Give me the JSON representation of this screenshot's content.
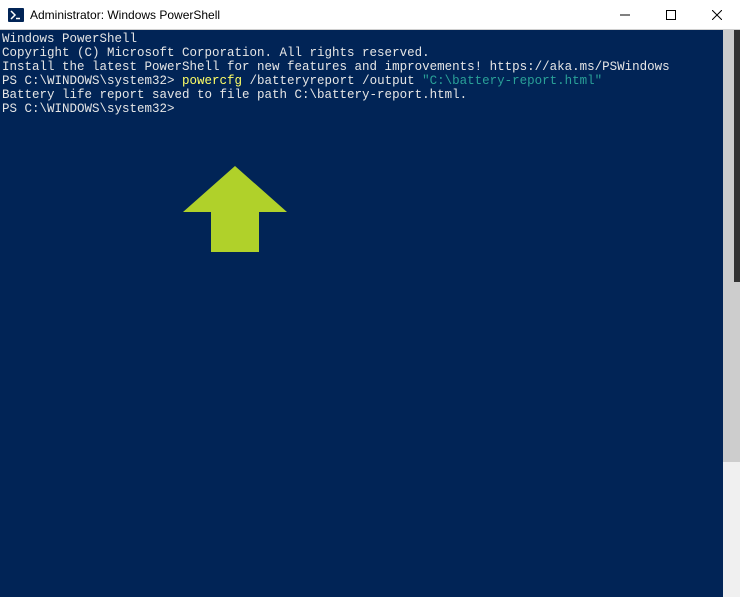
{
  "window": {
    "title": "Administrator: Windows PowerShell"
  },
  "terminal": {
    "line1": "Windows PowerShell",
    "line2": "Copyright (C) Microsoft Corporation. All rights reserved.",
    "line3_blank": "",
    "line4": "Install the latest PowerShell for new features and improvements! https://aka.ms/PSWindows",
    "line5_blank": "",
    "prompt1_prefix": "PS C:\\WINDOWS\\system32> ",
    "prompt1_cmd": "powercfg",
    "prompt1_args": " /batteryreport /output ",
    "prompt1_path": "\"C:\\battery-report.html\"",
    "line7": "Battery life report saved to file path C:\\battery-report.html.",
    "prompt2": "PS C:\\WINDOWS\\system32>"
  },
  "colors": {
    "terminal_bg": "#012456",
    "arrow": "#b0d12a"
  }
}
